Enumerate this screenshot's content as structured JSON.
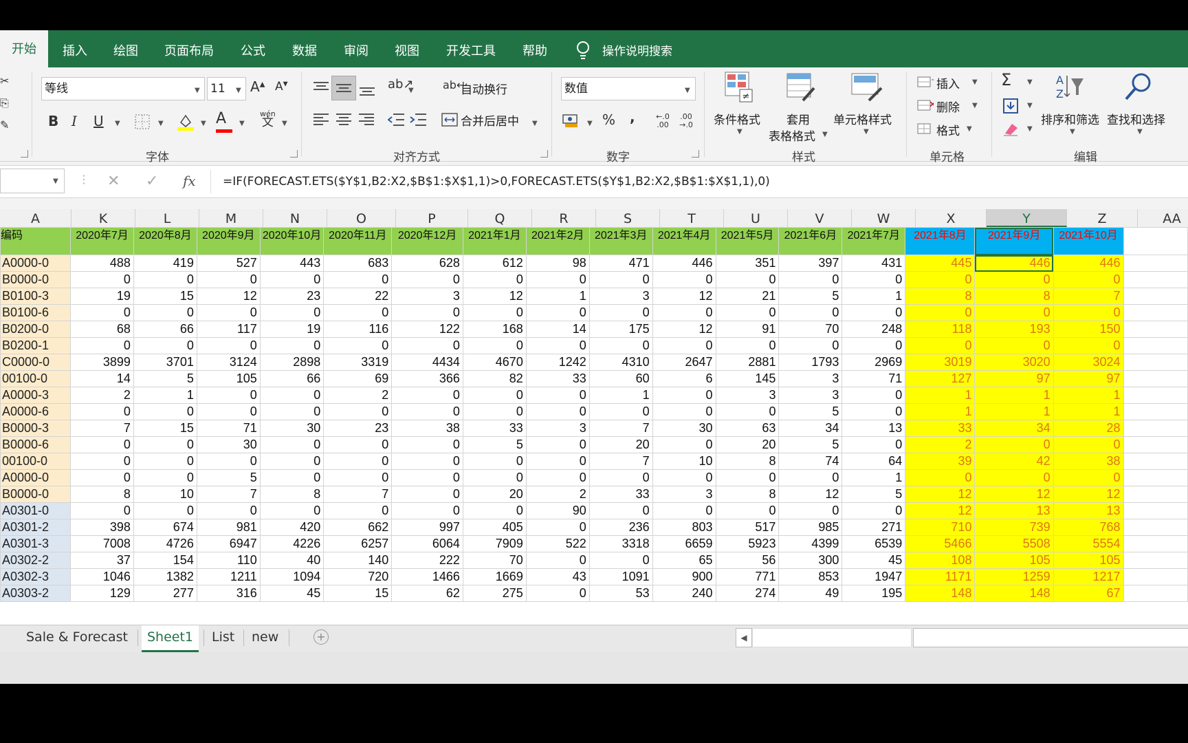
{
  "ribbon_tabs": [
    {
      "label": "开始",
      "active": true
    },
    {
      "label": "插入"
    },
    {
      "label": "绘图"
    },
    {
      "label": "页面布局"
    },
    {
      "label": "公式"
    },
    {
      "label": "数据"
    },
    {
      "label": "审阅"
    },
    {
      "label": "视图"
    },
    {
      "label": "开发工具"
    },
    {
      "label": "帮助"
    }
  ],
  "tell_me": "操作说明搜索",
  "font": {
    "name": "等线",
    "size": "11",
    "group_label": "字体",
    "bold": "B",
    "italic": "I",
    "underline": "U",
    "phonetic": "wén",
    "phonetic_char": "文"
  },
  "alignment": {
    "wrap_text": "自动换行",
    "merge_center": "合并后居中",
    "group_label": "对齐方式"
  },
  "number": {
    "format": "数值",
    "percent": "%",
    "comma": ",",
    "inc_decimal": "←.0 .00",
    "dec_decimal": ".00 →.0",
    "group_label": "数字"
  },
  "styles": {
    "conditional_format": "条件格式",
    "table_format_line1": "套用",
    "table_format_line2": "表格格式",
    "cell_styles": "单元格样式",
    "group_label": "样式"
  },
  "cells": {
    "insert": "插入",
    "delete": "删除",
    "format": "格式",
    "group_label": "单元格"
  },
  "editing": {
    "sum": "Σ",
    "sort_filter": "排序和筛选",
    "find_select": "查找和选择",
    "group_label": "编辑"
  },
  "formula_bar": {
    "fx": "fx",
    "cancel": "✕",
    "enter": "✓",
    "formula": "=IF(FORECAST.ETS($Y$1,B2:X2,$B$1:$X$1,1)>0,FORECAST.ETS($Y$1,B2:X2,$B$1:$X$1,1),0)"
  },
  "columns": [
    "A",
    "K",
    "L",
    "M",
    "N",
    "O",
    "P",
    "Q",
    "R",
    "S",
    "T",
    "U",
    "V",
    "W",
    "X",
    "Y",
    "Z",
    "AA"
  ],
  "selected_column": "Y",
  "header_row": {
    "a": "编码",
    "months": [
      "2020年7月",
      "2020年8月",
      "2020年9月",
      "2020年10月",
      "2020年11月",
      "2020年12月",
      "2021年1月",
      "2021年2月",
      "2021年3月",
      "2021年4月",
      "2021年5月",
      "2021年6月",
      "2021年7月",
      "2021年8月",
      "2021年9月",
      "2021年10月"
    ]
  },
  "rows": [
    {
      "code": "A0000-0",
      "color": "#fdeccc",
      "values": [
        488,
        419,
        527,
        443,
        683,
        628,
        612,
        98,
        471,
        446,
        351,
        397,
        431
      ],
      "forecast": [
        445,
        446,
        446
      ]
    },
    {
      "code": "B0000-0",
      "color": "#fdeccc",
      "values": [
        0,
        0,
        0,
        0,
        0,
        0,
        0,
        0,
        0,
        0,
        0,
        0,
        0
      ],
      "forecast": [
        0,
        0,
        0
      ]
    },
    {
      "code": "B0100-3",
      "color": "#fdeccc",
      "values": [
        19,
        15,
        12,
        23,
        22,
        3,
        12,
        1,
        3,
        12,
        21,
        5,
        1
      ],
      "forecast": [
        8,
        8,
        7
      ]
    },
    {
      "code": "B0100-6",
      "color": "#fdeccc",
      "values": [
        0,
        0,
        0,
        0,
        0,
        0,
        0,
        0,
        0,
        0,
        0,
        0,
        0
      ],
      "forecast": [
        0,
        0,
        0
      ]
    },
    {
      "code": "B0200-0",
      "color": "#fdeccc",
      "values": [
        68,
        66,
        117,
        19,
        116,
        122,
        168,
        14,
        175,
        12,
        91,
        70,
        248
      ],
      "forecast": [
        118,
        193,
        150
      ]
    },
    {
      "code": "B0200-1",
      "color": "#fdeccc",
      "values": [
        0,
        0,
        0,
        0,
        0,
        0,
        0,
        0,
        0,
        0,
        0,
        0,
        0
      ],
      "forecast": [
        0,
        0,
        0
      ]
    },
    {
      "code": "C0000-0",
      "color": "#fdeccc",
      "values": [
        3899,
        3701,
        3124,
        2898,
        3319,
        4434,
        4670,
        1242,
        4310,
        2647,
        2881,
        1793,
        2969
      ],
      "forecast": [
        3019,
        3020,
        3024
      ]
    },
    {
      "code": "00100-0",
      "color": "#fdeccc",
      "values": [
        14,
        5,
        105,
        66,
        69,
        366,
        82,
        33,
        60,
        6,
        145,
        3,
        71
      ],
      "forecast": [
        127,
        97,
        97
      ]
    },
    {
      "code": "A0000-3",
      "color": "#fdeccc",
      "values": [
        2,
        1,
        0,
        0,
        2,
        0,
        0,
        0,
        1,
        0,
        3,
        3,
        0
      ],
      "forecast": [
        1,
        1,
        1
      ]
    },
    {
      "code": "A0000-6",
      "color": "#fdeccc",
      "values": [
        0,
        0,
        0,
        0,
        0,
        0,
        0,
        0,
        0,
        0,
        0,
        5,
        0
      ],
      "forecast": [
        1,
        1,
        1
      ]
    },
    {
      "code": "B0000-3",
      "color": "#fdeccc",
      "values": [
        7,
        15,
        71,
        30,
        23,
        38,
        33,
        3,
        7,
        30,
        63,
        34,
        13
      ],
      "forecast": [
        33,
        34,
        28
      ]
    },
    {
      "code": "B0000-6",
      "color": "#fdeccc",
      "values": [
        0,
        0,
        30,
        0,
        0,
        0,
        5,
        0,
        20,
        0,
        20,
        5,
        0
      ],
      "forecast": [
        2,
        0,
        0
      ]
    },
    {
      "code": "00100-0",
      "color": "#fdeccc",
      "values": [
        0,
        0,
        0,
        0,
        0,
        0,
        0,
        0,
        7,
        10,
        8,
        74,
        64
      ],
      "forecast": [
        39,
        42,
        38
      ]
    },
    {
      "code": "A0000-0",
      "color": "#fdeccc",
      "values": [
        0,
        0,
        5,
        0,
        0,
        0,
        0,
        0,
        0,
        0,
        0,
        0,
        1
      ],
      "forecast": [
        0,
        0,
        0
      ]
    },
    {
      "code": "B0000-0",
      "color": "#fdeccc",
      "values": [
        8,
        10,
        7,
        8,
        7,
        0,
        20,
        2,
        33,
        3,
        8,
        12,
        5
      ],
      "forecast": [
        12,
        12,
        12
      ]
    },
    {
      "code": "A0301-0",
      "color": "#dce6f1",
      "values": [
        0,
        0,
        0,
        0,
        0,
        0,
        0,
        90,
        0,
        0,
        0,
        0,
        0
      ],
      "forecast": [
        12,
        13,
        13
      ]
    },
    {
      "code": "A0301-2",
      "color": "#dce6f1",
      "values": [
        398,
        674,
        981,
        420,
        662,
        997,
        405,
        0,
        236,
        803,
        517,
        985,
        271
      ],
      "forecast": [
        710,
        739,
        768
      ]
    },
    {
      "code": "A0301-3",
      "color": "#dce6f1",
      "values": [
        7008,
        4726,
        6947,
        4226,
        6257,
        6064,
        7909,
        522,
        3318,
        6659,
        5923,
        4399,
        6539
      ],
      "forecast": [
        5466,
        5508,
        5554
      ]
    },
    {
      "code": "A0302-2",
      "color": "#dce6f1",
      "values": [
        37,
        154,
        110,
        40,
        140,
        222,
        70,
        0,
        0,
        65,
        56,
        300,
        45
      ],
      "forecast": [
        108,
        105,
        105
      ]
    },
    {
      "code": "A0302-3",
      "color": "#dce6f1",
      "values": [
        1046,
        1382,
        1211,
        1094,
        720,
        1466,
        1669,
        43,
        1091,
        900,
        771,
        853,
        1947
      ],
      "forecast": [
        1171,
        1259,
        1217
      ]
    },
    {
      "code": "A0303-2",
      "color": "#dce6f1",
      "values": [
        129,
        277,
        316,
        45,
        15,
        62,
        275,
        0,
        53,
        240,
        274,
        49,
        195
      ],
      "forecast": [
        148,
        148,
        67
      ]
    }
  ],
  "sheet_tabs": [
    {
      "label": "Sale & Forecast"
    },
    {
      "label": "Sheet1",
      "active": true
    },
    {
      "label": "List"
    },
    {
      "label": "new"
    }
  ],
  "add_sheet": "+",
  "colors": {
    "brand": "#217346",
    "header_green": "#92d050",
    "forecast_blue": "#00b0f0",
    "forecast_yellow": "#ffff00"
  }
}
